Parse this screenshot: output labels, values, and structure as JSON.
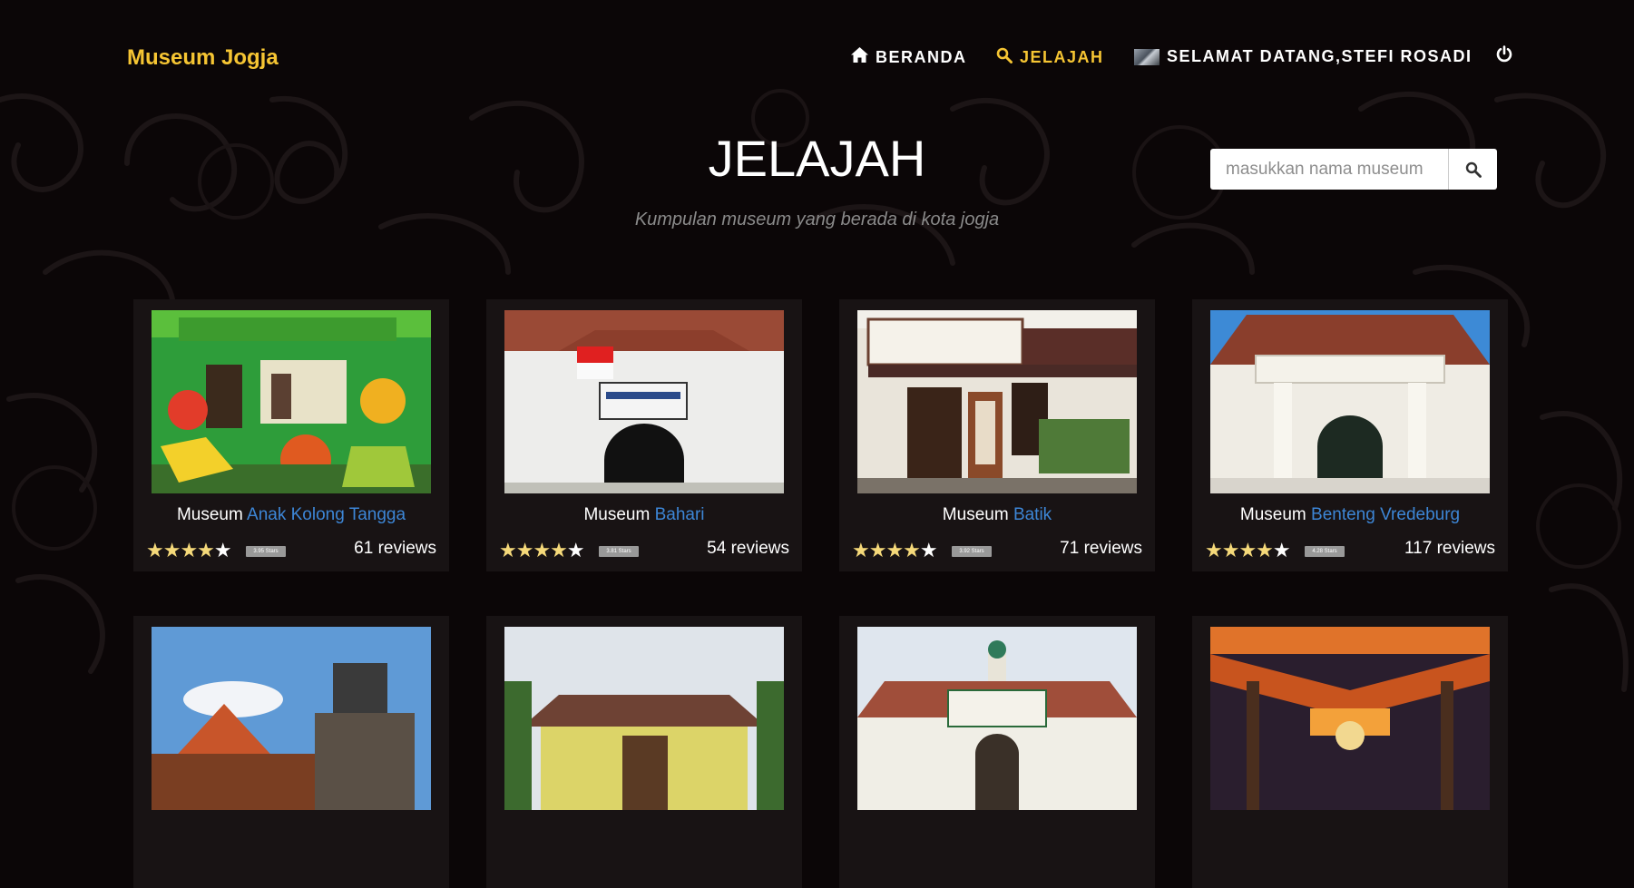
{
  "brand": "Museum Jogja",
  "nav": {
    "home": "BERANDA",
    "explore": "JELAJAH",
    "user": "SELAMAT DATANG,STEFI ROSADI"
  },
  "header": {
    "title": "JELAJAH",
    "subtitle": "Kumpulan museum yang berada di kota jogja"
  },
  "search": {
    "placeholder": "masukkan nama museum",
    "value": ""
  },
  "museums": [
    {
      "prefix": "Museum",
      "name": "Anak Kolong Tangga",
      "rating": 3.95,
      "badge": "3.95 Stars",
      "reviews": "61 reviews"
    },
    {
      "prefix": "Museum",
      "name": "Bahari",
      "rating": 3.81,
      "badge": "3.81 Stars",
      "reviews": "54 reviews"
    },
    {
      "prefix": "Museum",
      "name": "Batik",
      "rating": 3.92,
      "badge": "3.92 Stars",
      "reviews": "71 reviews"
    },
    {
      "prefix": "Museum",
      "name": "Benteng Vredeburg",
      "rating": 4.28,
      "badge": "4.28 Stars",
      "reviews": "117 reviews"
    },
    {
      "prefix": "",
      "name": "",
      "rating": null,
      "badge": "",
      "reviews": ""
    },
    {
      "prefix": "",
      "name": "",
      "rating": null,
      "badge": "",
      "reviews": ""
    },
    {
      "prefix": "",
      "name": "",
      "rating": null,
      "badge": "",
      "reviews": ""
    },
    {
      "prefix": "",
      "name": "",
      "rating": null,
      "badge": "",
      "reviews": ""
    }
  ],
  "colors": {
    "accent": "#f6c533",
    "link": "#3d86d6",
    "background": "#0b0607",
    "card": "#181314"
  },
  "icons": {
    "home": "home-icon",
    "search": "search-icon",
    "power": "power-icon"
  }
}
